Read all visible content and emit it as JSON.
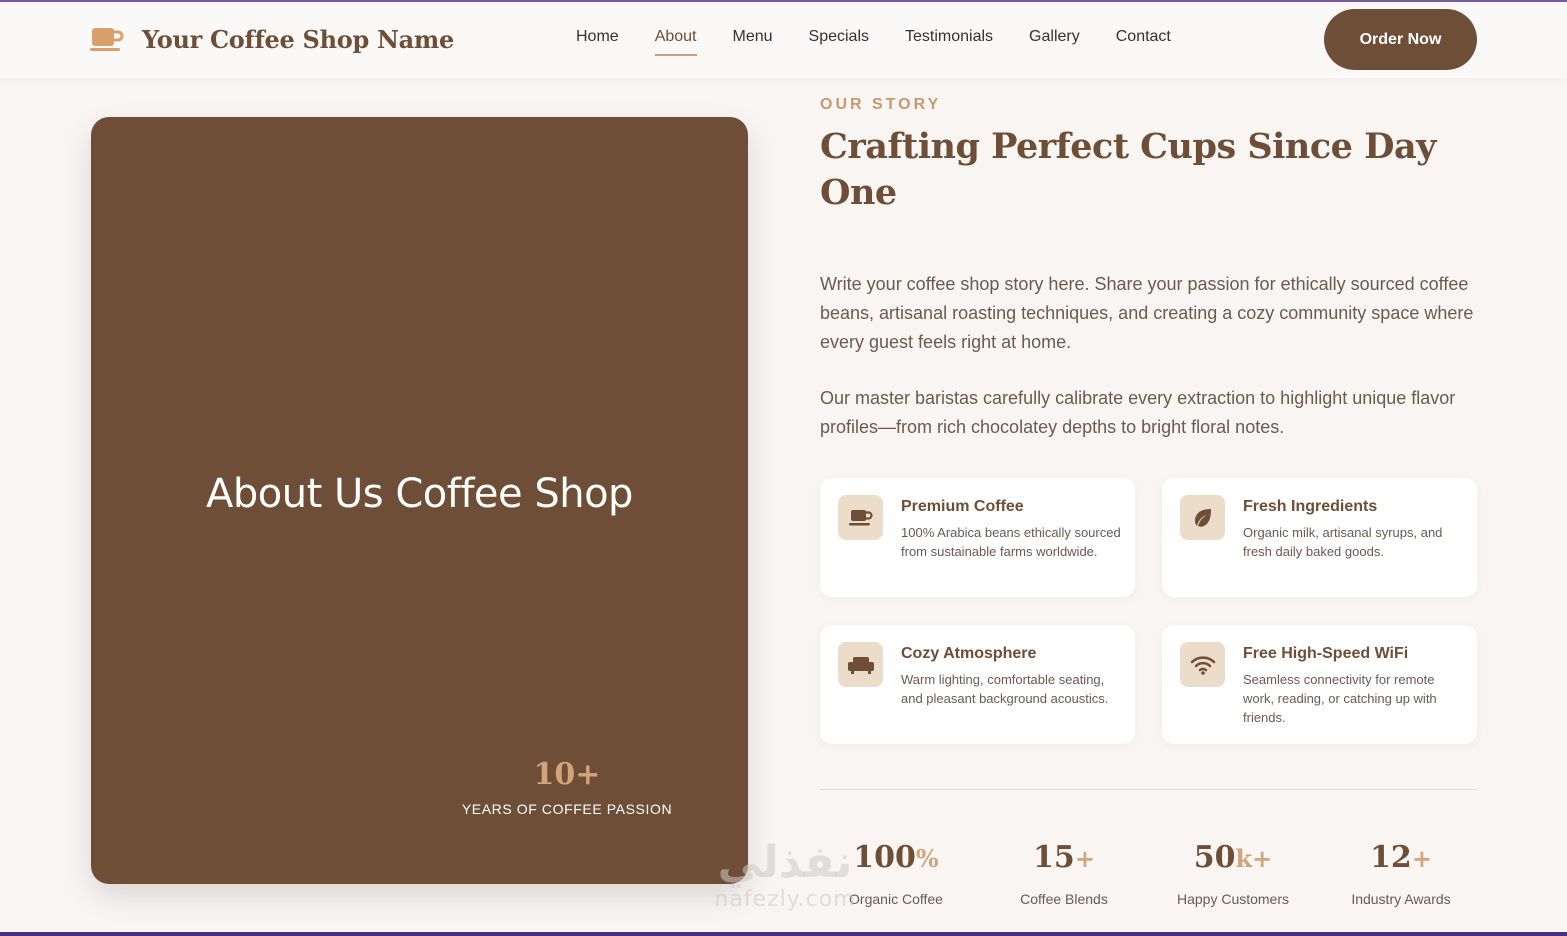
{
  "header": {
    "brand": "Your Coffee Shop Name",
    "nav": [
      {
        "label": "Home",
        "active": false
      },
      {
        "label": "About",
        "active": true
      },
      {
        "label": "Menu",
        "active": false
      },
      {
        "label": "Specials",
        "active": false
      },
      {
        "label": "Testimonials",
        "active": false
      },
      {
        "label": "Gallery",
        "active": false
      },
      {
        "label": "Contact",
        "active": false
      }
    ],
    "cta": "Order Now"
  },
  "hero": {
    "title": "About Us Coffee Shop",
    "years": "10+",
    "years_label": "YEARS OF COFFEE PASSION"
  },
  "story": {
    "eyebrow": "OUR STORY",
    "heading": "Crafting Perfect Cups Since Day One",
    "paragraphs": [
      "Write your coffee shop story here. Share your passion for ethically sourced coffee beans, artisanal roasting techniques, and creating a cozy community space where every guest feels right at home.",
      "Our master baristas carefully calibrate every extraction to highlight unique flavor profiles—from rich chocolatey depths to bright floral notes."
    ]
  },
  "features": [
    {
      "icon": "coffee-cup-icon",
      "title": "Premium Coffee",
      "desc": "100% Arabica beans ethically sourced from sustainable farms worldwide."
    },
    {
      "icon": "leaf-icon",
      "title": "Fresh Ingredients",
      "desc": "Organic milk, artisanal syrups, and fresh daily baked goods."
    },
    {
      "icon": "couch-icon",
      "title": "Cozy Atmosphere",
      "desc": "Warm lighting, comfortable seating, and pleasant background acoustics."
    },
    {
      "icon": "wifi-icon",
      "title": "Free High-Speed WiFi",
      "desc": "Seamless connectivity for remote work, reading, or catching up with friends."
    }
  ],
  "stats": [
    {
      "value": "100",
      "suffix": "%",
      "label": "Organic Coffee"
    },
    {
      "value": "15",
      "suffix": "+",
      "label": "Coffee Blends"
    },
    {
      "value": "50",
      "suffix": "k+",
      "label": "Happy Customers"
    },
    {
      "value": "12",
      "suffix": "+",
      "label": "Industry Awards"
    }
  ],
  "watermark": {
    "arabic": "نفذلي",
    "latin": "nafezly.com"
  },
  "colors": {
    "brand": "#6e4e36",
    "accent": "#c59a6e",
    "icon_bg": "#ecdcca",
    "page_bg": "#f8f5f2"
  }
}
